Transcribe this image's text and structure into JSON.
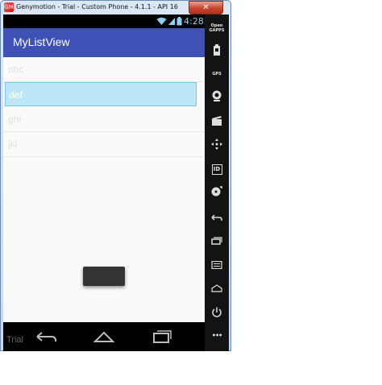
{
  "window": {
    "title": "Genymotion - Trial - Custom Phone - 4.1.1 - API 16 - 768x128...",
    "close_label": "✕",
    "app_icon_text": "GM"
  },
  "status_bar": {
    "time": "4:28",
    "icons": [
      "wifi-icon",
      "signal-icon",
      "battery-icon"
    ]
  },
  "app_bar": {
    "title": "MyListView"
  },
  "list": {
    "items": [
      {
        "label": "abc",
        "selected": false
      },
      {
        "label": "def",
        "selected": true
      },
      {
        "label": "ghi",
        "selected": false
      },
      {
        "label": "jkl",
        "selected": false
      }
    ]
  },
  "nav_bar": {
    "buttons": [
      "back-icon",
      "home-icon",
      "recent-apps-icon"
    ]
  },
  "sidebar": {
    "items": [
      {
        "icon": "open-gapps-icon",
        "text": "Open GAPPS"
      },
      {
        "icon": "battery-icon",
        "text": ""
      },
      {
        "icon": "gps-icon",
        "text": "GPS"
      },
      {
        "icon": "webcam-icon",
        "text": ""
      },
      {
        "icon": "clapper-icon",
        "text": ""
      },
      {
        "icon": "dpad-icon",
        "text": ""
      },
      {
        "icon": "id-icon",
        "text": "ID"
      },
      {
        "icon": "disk-icon",
        "text": ""
      },
      {
        "icon": "back-icon",
        "text": ""
      },
      {
        "icon": "recent-apps-icon",
        "text": ""
      },
      {
        "icon": "menu-icon",
        "text": ""
      },
      {
        "icon": "home-icon",
        "text": ""
      },
      {
        "icon": "power-icon",
        "text": ""
      },
      {
        "icon": "more-icon",
        "text": "•••"
      }
    ]
  },
  "watermark": "Trial",
  "colors": {
    "app_bar": "#3f51b5",
    "status_accent": "#8bd0f0",
    "selection": "#bde6f6"
  }
}
